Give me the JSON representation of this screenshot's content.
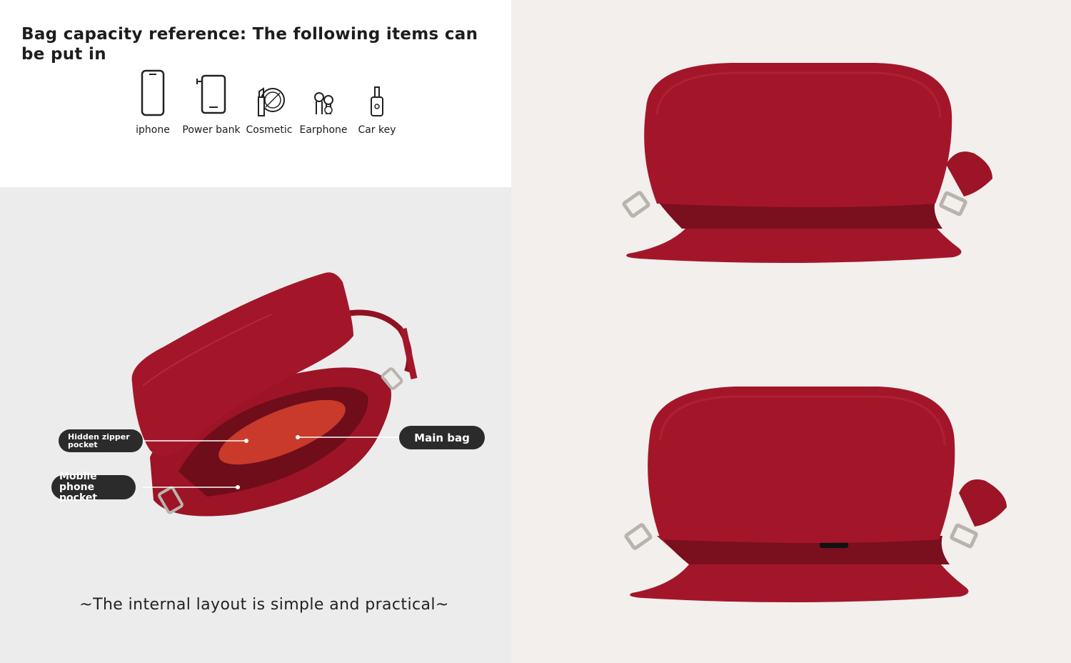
{
  "heading": "Bag capacity reference: The following items can be put in",
  "items": [
    {
      "label": "iphone",
      "icon": "phone-icon"
    },
    {
      "label": "Power bank",
      "icon": "power-bank-icon"
    },
    {
      "label": "Cosmetic",
      "icon": "cosmetic-icon"
    },
    {
      "label": "Earphone",
      "icon": "earphone-icon"
    },
    {
      "label": "Car key",
      "icon": "car-key-icon"
    }
  ],
  "callouts": {
    "hidden_zipper": "Hidden zipper pocket",
    "mobile_phone": "Mobile phone pocket",
    "main_bag": "Main bag"
  },
  "footer": "~The internal layout is simple and practical~",
  "colors": {
    "bag_red": "#a3162a",
    "bag_dark": "#7a0f1e",
    "callout_bg": "#2b2b2b",
    "top_panel": "#ffffff",
    "bottom_panel": "#edecec"
  }
}
